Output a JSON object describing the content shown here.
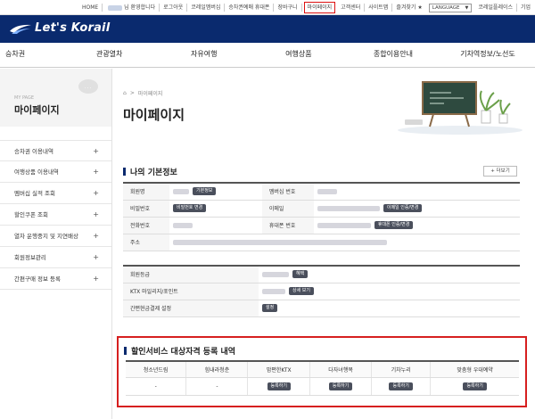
{
  "topbar": {
    "links": [
      "HOME",
      "님 환영합니다",
      "로그아웃",
      "코레일멤버십",
      "승차권예매 휴대폰",
      "장바구니",
      "마이페이지",
      "고객센터",
      "사이트맵",
      "즐겨찾기"
    ],
    "highlighted": "마이페이지",
    "language": "LANGUAGE",
    "extra_links": [
      "코레일플레이스",
      "기업"
    ]
  },
  "header": {
    "logo_text": "Let's Korail"
  },
  "gnb": [
    "승차권",
    "관광열차",
    "자유여행",
    "여행상품",
    "종합이용안내",
    "기차역정보/노선도"
  ],
  "lnb": {
    "small": "MY PAGE",
    "title": "마이페이지",
    "bubble": "...",
    "items": [
      "승차권 이용내역",
      "여행상품 이용내역",
      "멤버십 실적 조회",
      "할인쿠폰 조회",
      "열차 운행중지 및 지연배상",
      "회원정보관리",
      "간편구매 정보 등록"
    ],
    "plus": "+"
  },
  "breadcrumb": {
    "home_icon": "home-icon",
    "sep": ">",
    "page": "마이페이지"
  },
  "page_title": "마이페이지",
  "basic_info": {
    "title": "나의 기본정보",
    "more": "+ 더보기",
    "rows": [
      {
        "l1": "회원명",
        "b1": "기본정보",
        "l2": "멤버십 번호",
        "b2": ""
      },
      {
        "l1": "비밀번호",
        "b1": "비밀번호 변경",
        "l2": "이메일",
        "b2": "이메일 인증/변경"
      },
      {
        "l1": "전화번호",
        "b1": "",
        "l2": "휴대폰 번호",
        "b2": "휴대폰 인증/변경"
      },
      {
        "l1": "주소",
        "b1": "",
        "l2": "",
        "b2": ""
      }
    ]
  },
  "extra_info": {
    "rows": [
      {
        "label": "회원등급",
        "btn": "혜택"
      },
      {
        "label": "KTX 마일리지/포인트",
        "btn": "상세 보기"
      },
      {
        "label": "간편현금결제 설정",
        "btn": "설정"
      }
    ]
  },
  "discount": {
    "title": "할인서비스 대상자격 등록 내역",
    "headers": [
      "청소년드림",
      "힘내라청춘",
      "맘편한KTX",
      "다자녀행복",
      "기차누리",
      "맞춤형 우대예약"
    ],
    "values": [
      "-",
      "-",
      "",
      "",
      "",
      ""
    ],
    "button_label": "등록하기"
  },
  "colors": {
    "header": "#0a2a6e",
    "highlight": "#d61f1f"
  }
}
